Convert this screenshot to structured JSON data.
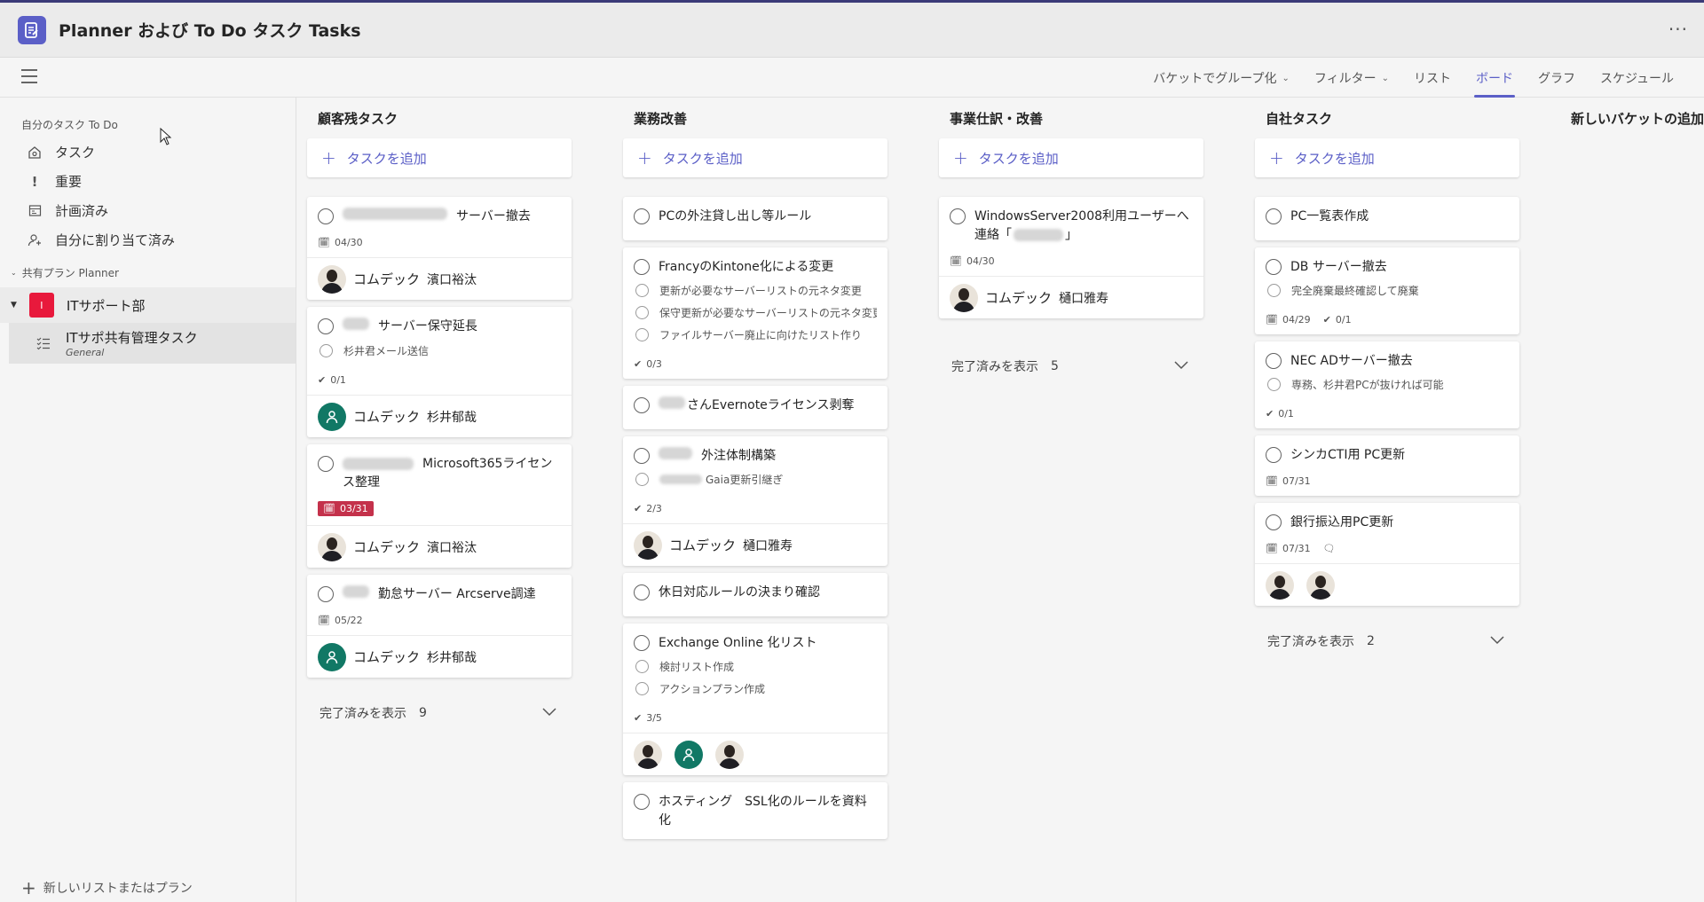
{
  "header": {
    "title": "Planner および To Do タスク Tasks"
  },
  "toolbar": {
    "group_by": "バケットでグループ化",
    "filter": "フィルター",
    "views": [
      "リスト",
      "ボード",
      "グラフ",
      "スケジュール"
    ],
    "active_view": "ボード"
  },
  "sidebar": {
    "my_tasks_section": "自分のタスク To Do",
    "items": [
      {
        "label": "タスク",
        "icon": "home-icon"
      },
      {
        "label": "重要",
        "icon": "exclamation-icon"
      },
      {
        "label": "計画済み",
        "icon": "calendar-icon"
      },
      {
        "label": "自分に割り当て済み",
        "icon": "person-assign-icon"
      }
    ],
    "shared_section": "共有プラン Planner",
    "plan": {
      "badge": "I",
      "name": "ITサポート部"
    },
    "subplan": {
      "name": "ITサポ共有管理タスク",
      "channel": "General"
    },
    "new_list": "新しいリストまたはプラン"
  },
  "board": {
    "add_task_label": "タスクを追加",
    "new_bucket_label": "新しいバケットの追加",
    "show_completed_label": "完了済みを表示",
    "assignee_company": "コムデック",
    "buckets": [
      {
        "title": "顧客残タスク",
        "completed_count": "9",
        "cards": [
          {
            "title": "サーバー撤去",
            "date": "04/30",
            "assignee": "濱口裕汰"
          },
          {
            "title": "サーバー保守延長",
            "check": "杉井君メール送信",
            "progress": "0/1",
            "assignee": "杉井郁哉"
          },
          {
            "title": "Microsoft365ライセンス整理",
            "date": "03/31",
            "assignee": "濱口裕汰"
          },
          {
            "title": "勤怠サーバー Arcserve調達",
            "date": "05/22",
            "assignee": "杉井郁哉"
          }
        ]
      },
      {
        "title": "業務改善",
        "cards": [
          {
            "title": "PCの外注貸し出し等ルール"
          },
          {
            "title": "FrancyのKintone化による変更",
            "checks": [
              "更新が必要なサーバーリストの元ネタ変更",
              "保守更新が必要なサーバーリストの元ネタ変更",
              "ファイルサーバー廃止に向けたリスト作り"
            ],
            "progress": "0/3"
          },
          {
            "title": "さんEvernoteライセンス剥奪"
          },
          {
            "title": "外注体制構築",
            "check": "Gaia更新引継ぎ",
            "progress": "2/3",
            "assignee": "樋口雅寿"
          },
          {
            "title": "休日対応ルールの決まり確認"
          },
          {
            "title": "Exchange Online 化リスト",
            "checks": [
              "検討リスト作成",
              "アクションプラン作成"
            ],
            "progress": "3/5"
          },
          {
            "title": "ホスティング　SSL化のルールを資料化"
          }
        ]
      },
      {
        "title": "事業仕訳・改善",
        "completed_count": "5",
        "cards": [
          {
            "title": "WindowsServer2008利用ユーザーへ連絡「",
            "title_end": "」",
            "date": "04/30",
            "assignee": "樋口雅寿"
          }
        ]
      },
      {
        "title": "自社タスク",
        "completed_count": "2",
        "cards": [
          {
            "title": "PC一覧表作成"
          },
          {
            "title": "DB サーバー撤去",
            "check": "完全廃棄最終確認して廃棄",
            "date": "04/29",
            "progress": "0/1"
          },
          {
            "title": "NEC ADサーバー撤去",
            "check": "専務、杉井君PCが抜ければ可能",
            "progress": "0/1"
          },
          {
            "title": "シンカCTI用 PC更新",
            "date": "07/31"
          },
          {
            "title": "銀行振込用PC更新",
            "date": "07/31"
          }
        ]
      }
    ]
  },
  "colors": {
    "accent": "#5b5fc7",
    "overdue": "#c4314b",
    "plan_badge": "#e8193c",
    "teal_avatar": "#117865"
  }
}
